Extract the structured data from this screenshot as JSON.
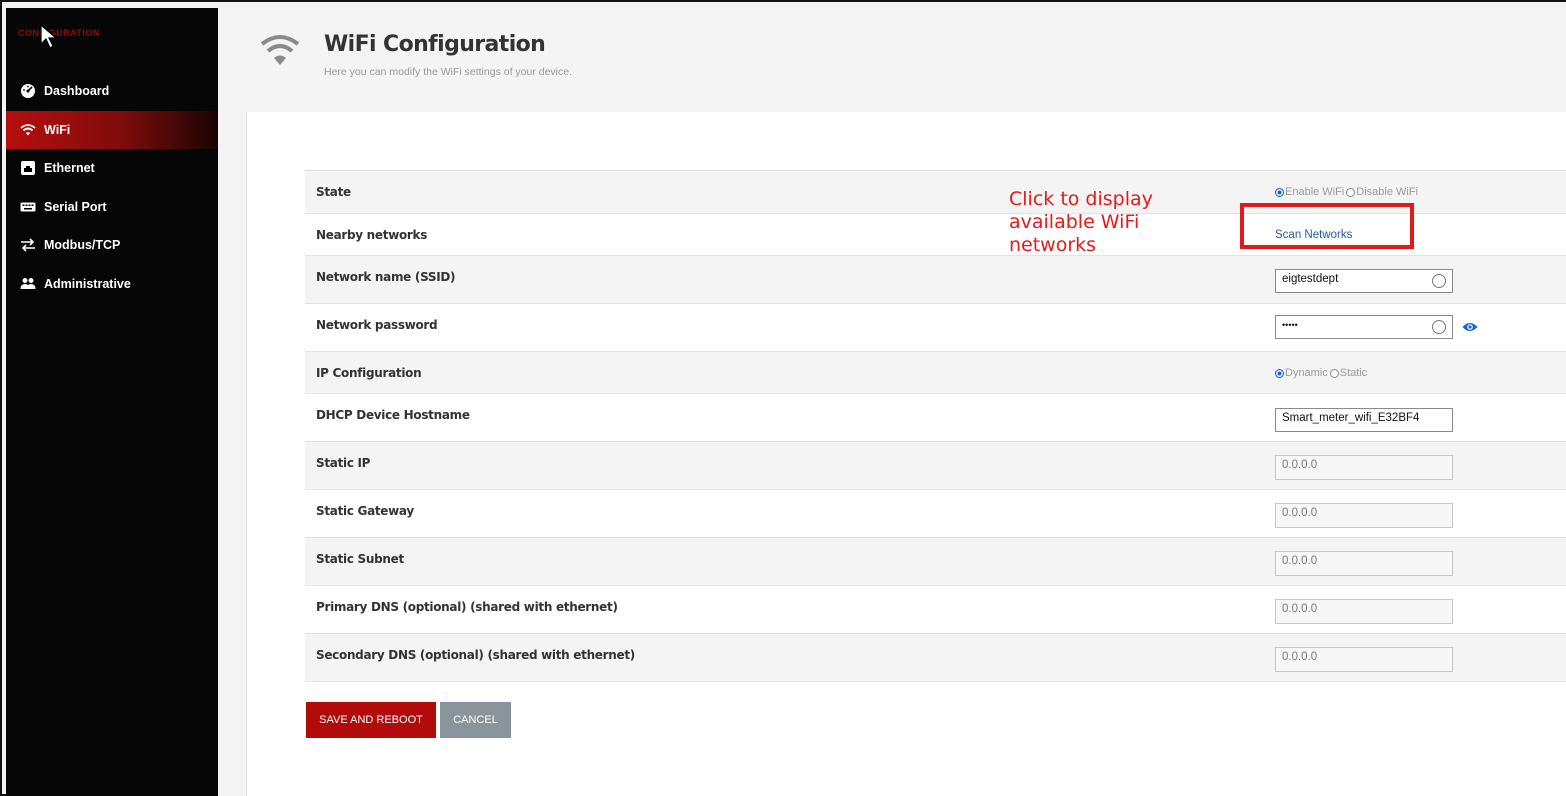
{
  "sidebar": {
    "brand": "CONFIGURATION",
    "items": [
      {
        "label": "Dashboard",
        "icon": "dashboard-gauge-icon"
      },
      {
        "label": "WiFi",
        "icon": "wifi-icon",
        "active": true
      },
      {
        "label": "Ethernet",
        "icon": "ethernet-port-icon"
      },
      {
        "label": "Serial Port",
        "icon": "keyboard-icon"
      },
      {
        "label": "Modbus/TCP",
        "icon": "exchange-arrows-icon"
      },
      {
        "label": "Administrative",
        "icon": "users-icon"
      }
    ]
  },
  "header": {
    "title": "WiFi Configuration",
    "subtitle": "Here you can modify the WiFi settings of your device."
  },
  "form": {
    "state": {
      "label": "State",
      "opt1": "Enable WiFi",
      "opt2": "Disable WiFi",
      "selected": "Enable WiFi"
    },
    "nearby": {
      "label": "Nearby networks",
      "link": "Scan Networks"
    },
    "ssid": {
      "label": "Network name (SSID)",
      "value": "eigtestdept"
    },
    "password": {
      "label": "Network password",
      "value": "•••••"
    },
    "ipconfig": {
      "label": "IP Configuration",
      "opt1": "Dynamic",
      "opt2": "Static",
      "selected": "Dynamic"
    },
    "hostname": {
      "label": "DHCP Device Hostname",
      "value": "Smart_meter_wifi_E32BF4"
    },
    "static_ip": {
      "label": "Static IP",
      "value": "0.0.0.0"
    },
    "static_gateway": {
      "label": "Static Gateway",
      "value": "0.0.0.0"
    },
    "static_subnet": {
      "label": "Static Subnet",
      "value": "0.0.0.0"
    },
    "primary_dns": {
      "label": "Primary DNS (optional) (shared with ethernet)",
      "value": "0.0.0.0"
    },
    "secondary_dns": {
      "label": "Secondary DNS (optional) (shared with ethernet)",
      "value": "0.0.0.0"
    }
  },
  "buttons": {
    "save": "SAVE AND REBOOT",
    "cancel": "CANCEL"
  },
  "annotation": {
    "line1": "Click to display",
    "line2": "available WiFi",
    "line3": "networks"
  },
  "colors": {
    "accent": "#b10b0b",
    "highlight": "#e01b1b",
    "link": "#1d5aa8"
  }
}
